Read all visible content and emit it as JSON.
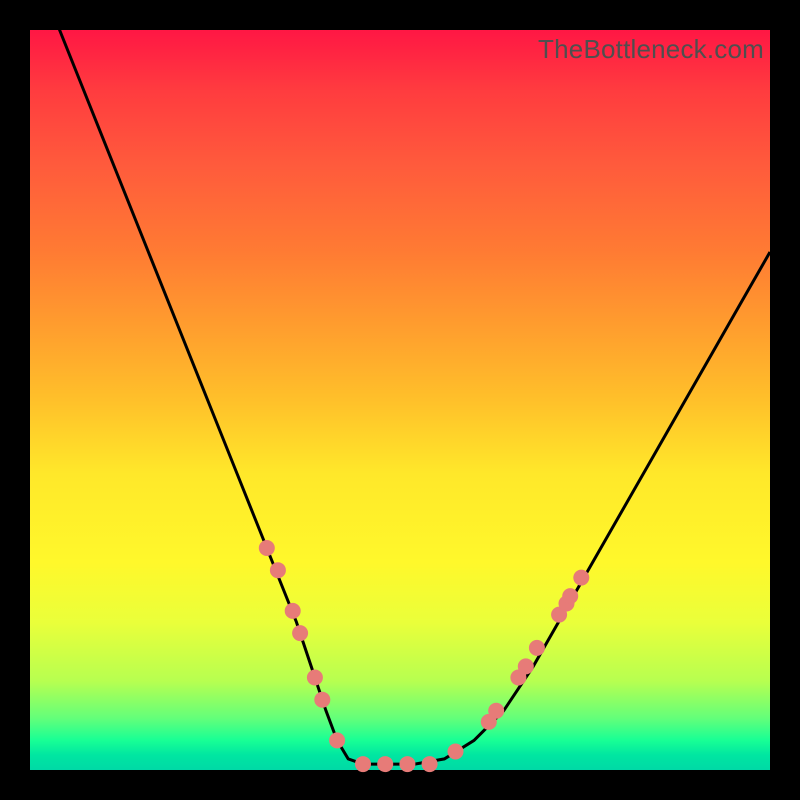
{
  "watermark": "TheBottleneck.com",
  "chart_data": {
    "type": "line",
    "title": "",
    "xlabel": "",
    "ylabel": "",
    "xlim": [
      0,
      100
    ],
    "ylim": [
      0,
      100
    ],
    "series": [
      {
        "name": "curve",
        "x": [
          0,
          4,
          8,
          12,
          16,
          20,
          24,
          28,
          32,
          34,
          36,
          38,
          40,
          41.5,
          43,
          45,
          48,
          52,
          56,
          60,
          64,
          68,
          72,
          76,
          80,
          84,
          88,
          92,
          96,
          100
        ],
        "y": [
          110,
          100,
          90,
          80,
          70,
          60,
          50,
          40,
          30,
          25,
          20,
          14,
          8,
          4,
          1.5,
          0.8,
          0.8,
          0.8,
          1.5,
          4,
          8,
          14,
          21,
          28,
          35,
          42,
          49,
          56,
          63,
          70
        ]
      }
    ],
    "markers": {
      "name": "dots",
      "color": "#e77b78",
      "radius_px": 8,
      "points": [
        {
          "x": 32.0,
          "y": 30.0
        },
        {
          "x": 33.5,
          "y": 27.0
        },
        {
          "x": 35.5,
          "y": 21.5
        },
        {
          "x": 36.5,
          "y": 18.5
        },
        {
          "x": 38.5,
          "y": 12.5
        },
        {
          "x": 39.5,
          "y": 9.5
        },
        {
          "x": 41.5,
          "y": 4.0
        },
        {
          "x": 45.0,
          "y": 0.8
        },
        {
          "x": 48.0,
          "y": 0.8
        },
        {
          "x": 51.0,
          "y": 0.8
        },
        {
          "x": 54.0,
          "y": 0.8
        },
        {
          "x": 57.5,
          "y": 2.5
        },
        {
          "x": 62.0,
          "y": 6.5
        },
        {
          "x": 63.0,
          "y": 8.0
        },
        {
          "x": 66.0,
          "y": 12.5
        },
        {
          "x": 67.0,
          "y": 14.0
        },
        {
          "x": 68.5,
          "y": 16.5
        },
        {
          "x": 71.5,
          "y": 21.0
        },
        {
          "x": 72.5,
          "y": 22.5
        },
        {
          "x": 73.0,
          "y": 23.5
        },
        {
          "x": 74.5,
          "y": 26.0
        }
      ]
    }
  }
}
